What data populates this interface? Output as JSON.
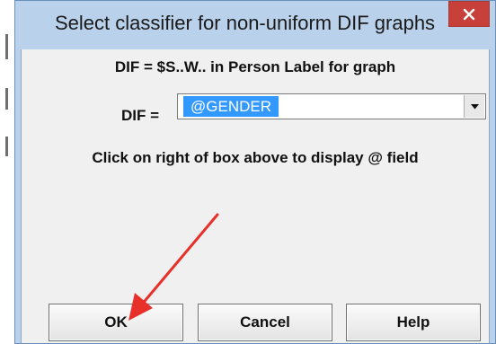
{
  "dialog": {
    "title": "Select classifier for non-uniform DIF graphs",
    "close_icon": "close-icon"
  },
  "content": {
    "line1": "DIF = $S..W.. in Person Label for graph",
    "dif_label": "DIF =",
    "dif_value": "@GENDER",
    "dropdown_icon": "chevron-down-icon",
    "hint": "Click on right of box above to display @ field"
  },
  "buttons": {
    "ok": "OK",
    "cancel": "Cancel",
    "help": "Help"
  },
  "annotation": {
    "arrow_color": "#e8302a"
  },
  "colors": {
    "titlebar": "#b9d1ea",
    "close": "#c7413a",
    "selection": "#3399ff"
  }
}
